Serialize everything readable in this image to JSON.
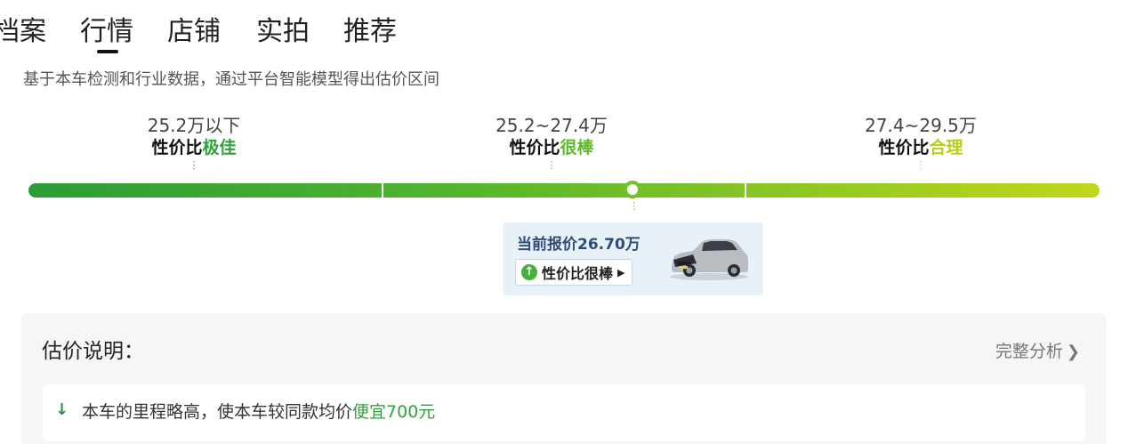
{
  "tabs": [
    {
      "label": "档案"
    },
    {
      "label": "行情"
    },
    {
      "label": "店铺"
    },
    {
      "label": "实拍"
    },
    {
      "label": "推荐"
    }
  ],
  "active_tab": "行情",
  "subtitle": "基于本车检测和行业数据，通过平台智能模型得出估价区间",
  "segments": [
    {
      "range": "25.2万以下",
      "rating_prefix": "性价比",
      "rating_value": "极佳",
      "color": "#2fa33a"
    },
    {
      "range": "25.2~27.4万",
      "rating_prefix": "性价比",
      "rating_value": "很棒",
      "color": "#5dbb2a"
    },
    {
      "range": "27.4~29.5万",
      "rating_prefix": "性价比",
      "rating_value": "合理",
      "color": "#b8cf17"
    }
  ],
  "bar_colors": {
    "start": "#2a9d36",
    "end": "#c2d61a"
  },
  "current_price": {
    "text": "当前报价26.70万",
    "badge": "性价比很棒",
    "badge_icon": "up-arrow-icon",
    "car_image": "car-image"
  },
  "panel": {
    "title": "估价说明：",
    "link": "完整分析",
    "note": {
      "icon": "down-arrow-icon",
      "text_before": "本车的里程略高，使本车较同款均价",
      "highlight": "便宜700元"
    }
  }
}
